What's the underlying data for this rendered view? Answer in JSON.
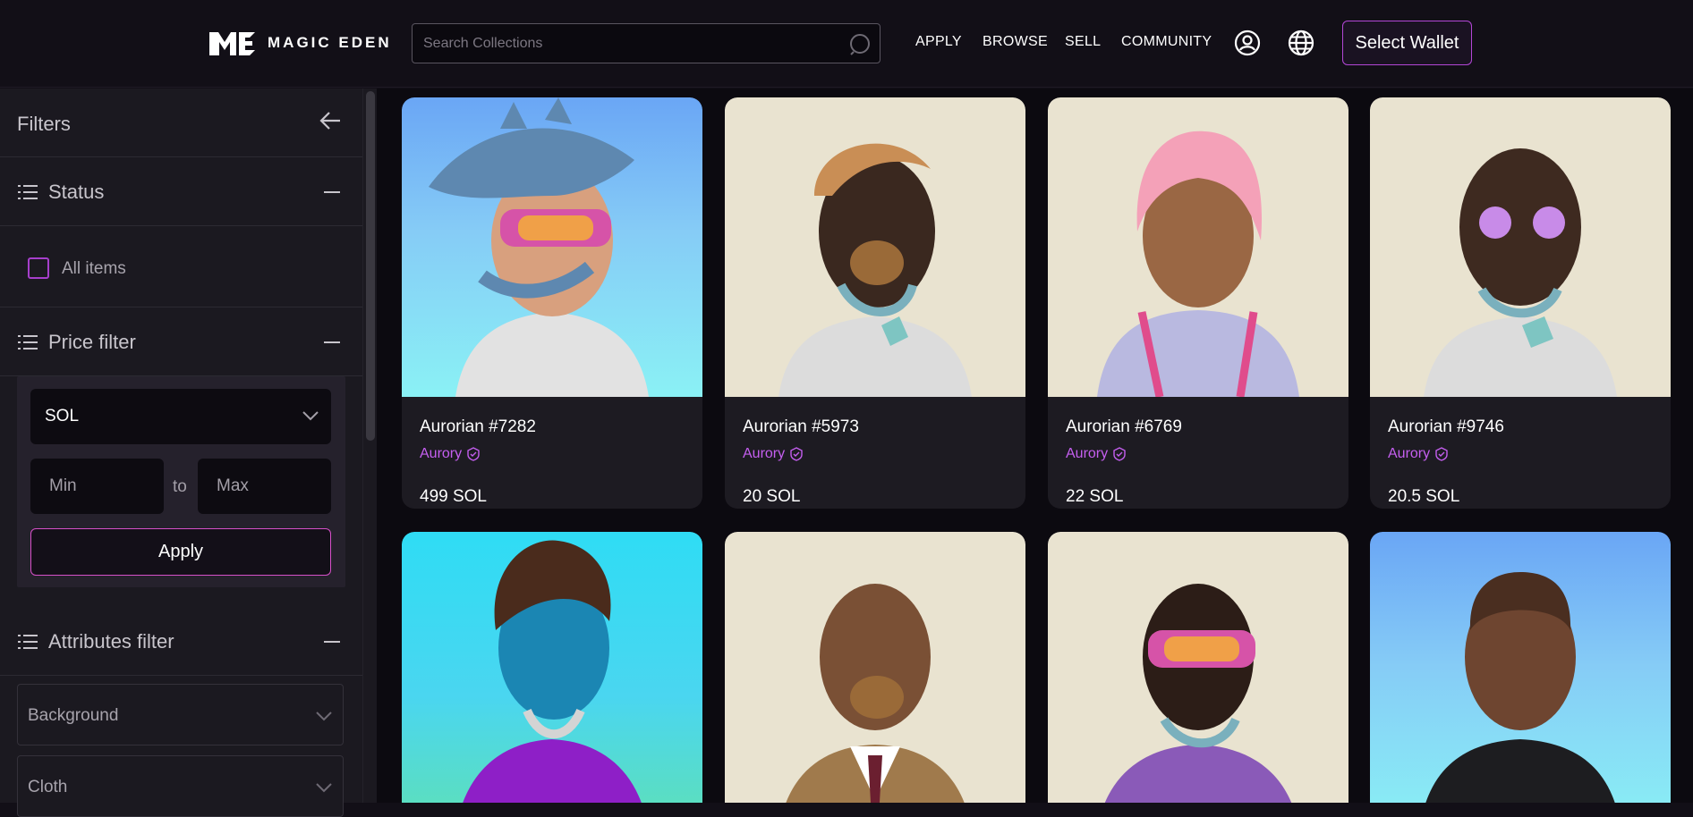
{
  "header": {
    "logo_text": "MAGIC EDEN",
    "search_placeholder": "Search Collections",
    "nav": [
      "APPLY",
      "BROWSE",
      "SELL",
      "COMMUNITY"
    ],
    "wallet_button": "Select Wallet",
    "icons": [
      "search-icon",
      "user-icon",
      "globe-icon"
    ]
  },
  "sidebar": {
    "title": "Filters",
    "status": {
      "label": "Status",
      "all_items": "All items"
    },
    "price": {
      "label": "Price filter",
      "currency": "SOL",
      "min_placeholder": "Min",
      "to": "to",
      "max_placeholder": "Max",
      "apply": "Apply"
    },
    "attributes": {
      "label": "Attributes filter",
      "items": [
        "Background",
        "Cloth"
      ]
    }
  },
  "cards": [
    {
      "name": "Aurorian #7282",
      "collection": "Aurory",
      "price": "499 SOL"
    },
    {
      "name": "Aurorian #5973",
      "collection": "Aurory",
      "price": "20 SOL"
    },
    {
      "name": "Aurorian #6769",
      "collection": "Aurory",
      "price": "22 SOL"
    },
    {
      "name": "Aurorian #9746",
      "collection": "Aurory",
      "price": "20.5 SOL"
    }
  ],
  "colors": {
    "accent": "#b346d6",
    "collection": "#c55ff0",
    "background": "#120f17"
  }
}
